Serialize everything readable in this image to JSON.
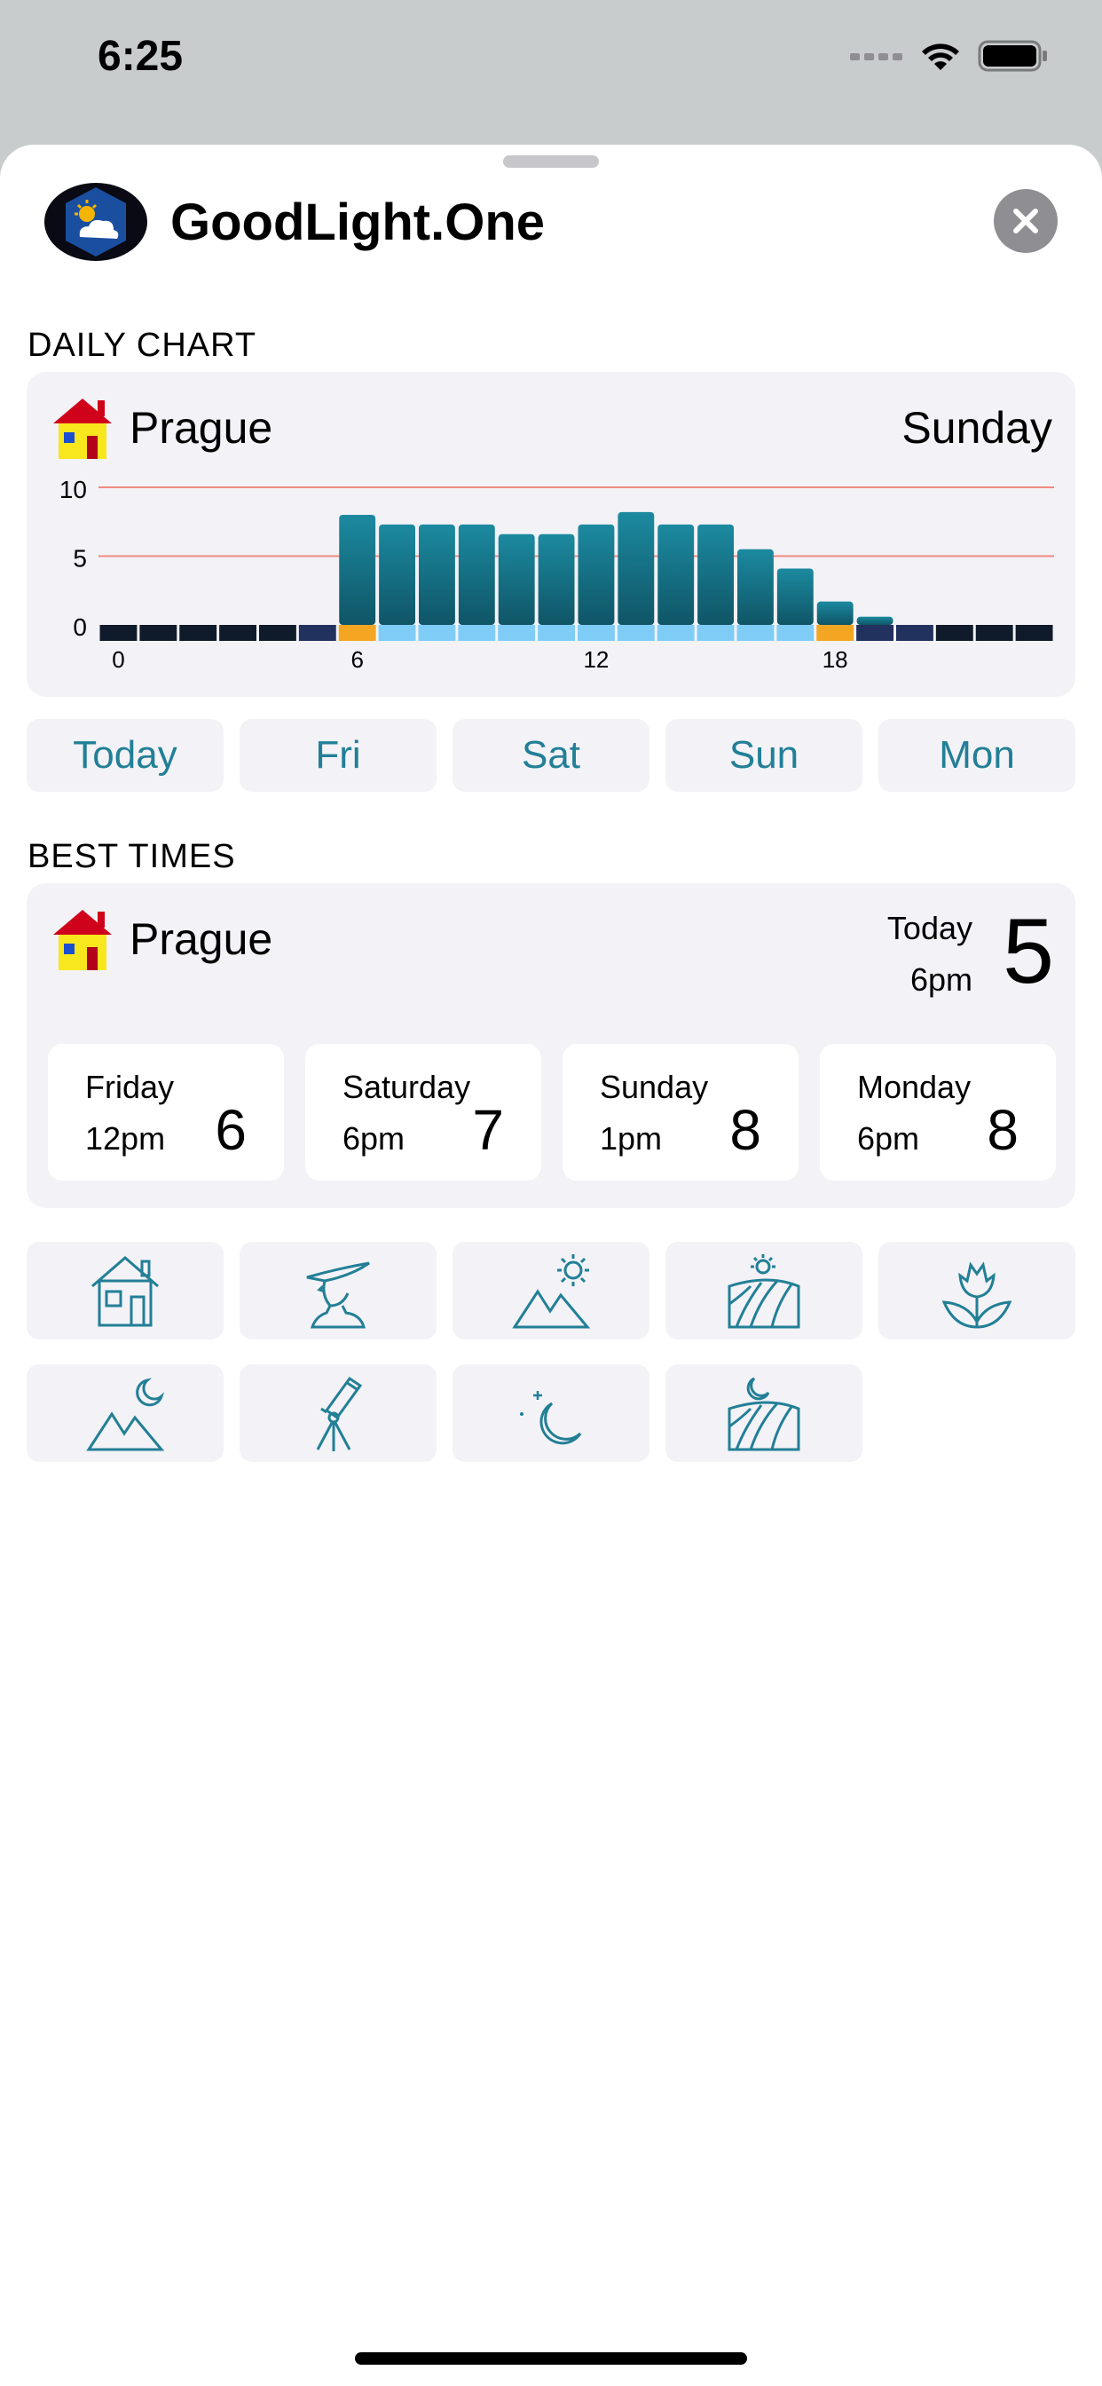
{
  "status": {
    "time": "6:25"
  },
  "app": {
    "title": "GoodLight.One"
  },
  "daily_chart": {
    "section_title": "DAILY CHART",
    "city": "Prague",
    "day": "Sunday"
  },
  "day_tabs": [
    "Today",
    "Fri",
    "Sat",
    "Sun",
    "Mon"
  ],
  "best_times": {
    "section_title": "BEST TIMES",
    "city": "Prague",
    "today": {
      "label": "Today",
      "time": "6pm",
      "score": "5"
    },
    "days": [
      {
        "day": "Friday",
        "time": "12pm",
        "score": "6"
      },
      {
        "day": "Saturday",
        "time": "6pm",
        "score": "7"
      },
      {
        "day": "Sunday",
        "time": "1pm",
        "score": "8"
      },
      {
        "day": "Monday",
        "time": "6pm",
        "score": "8"
      }
    ]
  },
  "activity_icons": [
    "house-icon",
    "hiker-icon",
    "mountain-sun-icon",
    "field-sun-icon",
    "flower-icon",
    "mountain-moon-icon",
    "telescope-icon",
    "moon-stars-icon",
    "field-moon-icon"
  ],
  "colors": {
    "accent": "#227f96",
    "bar": "#1c8aa0",
    "gridline": "#f08a80",
    "night": "#0f1b2a",
    "twilight": "#22325e",
    "golden": "#f4a623",
    "day": "#7fcdf6"
  },
  "chart_data": {
    "type": "bar",
    "x": [
      0,
      1,
      2,
      3,
      4,
      5,
      6,
      7,
      8,
      9,
      10,
      11,
      12,
      13,
      14,
      15,
      16,
      17,
      18,
      19,
      20,
      21,
      22,
      23
    ],
    "values": [
      0,
      0,
      0,
      0,
      0,
      0,
      8.0,
      7.3,
      7.3,
      7.3,
      6.6,
      6.6,
      7.3,
      8.2,
      7.3,
      7.3,
      5.5,
      4.1,
      1.7,
      0.6,
      0,
      0,
      0,
      0
    ],
    "xticks": [
      "0",
      "6",
      "12",
      "18"
    ],
    "yticks": [
      "0",
      "5",
      "10"
    ],
    "ylim": [
      0,
      10
    ]
  }
}
